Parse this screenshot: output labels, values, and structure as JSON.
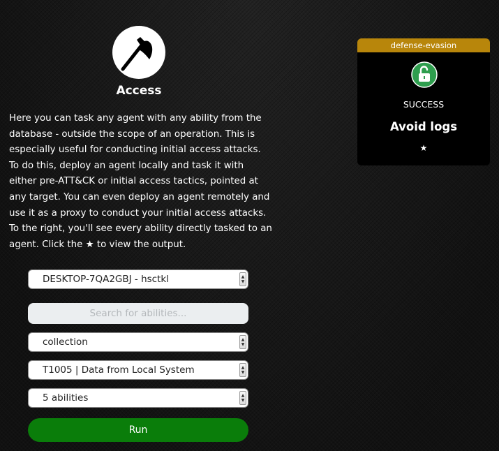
{
  "header": {
    "title": "Access",
    "icon": "axe-icon"
  },
  "description": "Here you can task any agent with any ability from the database - outside the scope of an operation. This is especially useful for conducting initial access attacks. To do this, deploy an agent locally and task it with either pre-ATT&CK or initial access tactics, pointed at any target. You can even deploy an agent remotely and use it as a proxy to conduct your initial access attacks. To the right, you'll see every ability directly tasked to an agent. Click the ★ to view the output.",
  "form": {
    "agent_select": "DESKTOP-7QA2GBJ - hsctkl",
    "search_placeholder": "Search for abilities...",
    "tactic_select": "collection",
    "technique_select": "T1005 | Data from Local System",
    "abilities_select": "5 abilities",
    "run_label": "Run"
  },
  "result_card": {
    "tactic": "defense-evasion",
    "status": "SUCCESS",
    "ability": "Avoid logs",
    "output_star": "★",
    "status_icon": "unlock-icon",
    "colors": {
      "header": "#b8860b",
      "success": "#2e9e4e"
    }
  },
  "colors": {
    "run_button": "#0a7d0a"
  }
}
